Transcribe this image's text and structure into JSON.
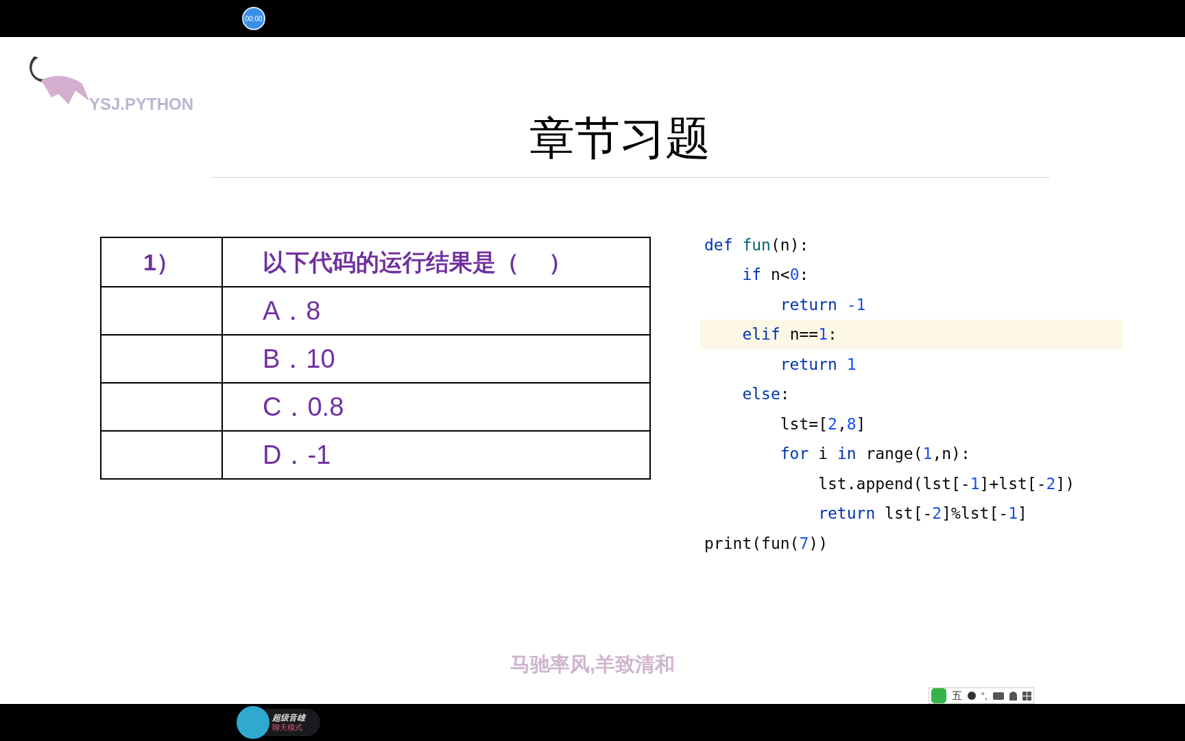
{
  "player": {
    "timer": "00:00"
  },
  "slide": {
    "logo_text": "YSJ.PYTHON",
    "title": "章节习题",
    "table": {
      "rows": [
        {
          "number": "1）",
          "text": "以下代码的运行结果是（　 ）",
          "kind": "question"
        },
        {
          "number": "",
          "text": "A．8",
          "kind": "option"
        },
        {
          "number": "",
          "text": "B．10",
          "kind": "option"
        },
        {
          "number": "",
          "text": "C．0.8",
          "kind": "option"
        },
        {
          "number": "",
          "text": "D．-1",
          "kind": "option"
        }
      ]
    },
    "code": [
      {
        "highlighted": false,
        "tokens": [
          {
            "t": "def ",
            "kind": "kw"
          },
          {
            "t": "fun",
            "kind": "fn"
          },
          {
            "t": "(n):",
            "kind": "plain"
          }
        ]
      },
      {
        "highlighted": false,
        "tokens": [
          {
            "t": "    if ",
            "kind": "kw"
          },
          {
            "t": "n<",
            "kind": "plain"
          },
          {
            "t": "0",
            "kind": "num"
          },
          {
            "t": ":",
            "kind": "plain"
          }
        ]
      },
      {
        "highlighted": false,
        "tokens": [
          {
            "t": "        return ",
            "kind": "kw"
          },
          {
            "t": "-1",
            "kind": "num"
          }
        ]
      },
      {
        "highlighted": true,
        "tokens": [
          {
            "t": "    elif ",
            "kind": "kw"
          },
          {
            "t": "n==",
            "kind": "plain"
          },
          {
            "t": "1",
            "kind": "num"
          },
          {
            "t": ":",
            "kind": "plain"
          }
        ]
      },
      {
        "highlighted": false,
        "tokens": [
          {
            "t": "        return ",
            "kind": "kw"
          },
          {
            "t": "1",
            "kind": "num"
          }
        ]
      },
      {
        "highlighted": false,
        "tokens": [
          {
            "t": "    else",
            "kind": "kw"
          },
          {
            "t": ":",
            "kind": "plain"
          }
        ]
      },
      {
        "highlighted": false,
        "tokens": [
          {
            "t": "        lst=[",
            "kind": "plain"
          },
          {
            "t": "2",
            "kind": "num"
          },
          {
            "t": ",",
            "kind": "plain"
          },
          {
            "t": "8",
            "kind": "num"
          },
          {
            "t": "]",
            "kind": "plain"
          }
        ]
      },
      {
        "highlighted": false,
        "tokens": [
          {
            "t": "        for ",
            "kind": "kw"
          },
          {
            "t": "i ",
            "kind": "plain"
          },
          {
            "t": "in ",
            "kind": "kw"
          },
          {
            "t": "range(",
            "kind": "plain"
          },
          {
            "t": "1",
            "kind": "num"
          },
          {
            "t": ",n):",
            "kind": "plain"
          }
        ]
      },
      {
        "highlighted": false,
        "tokens": [
          {
            "t": "            lst.append(lst[-",
            "kind": "plain"
          },
          {
            "t": "1",
            "kind": "num"
          },
          {
            "t": "]+lst[-",
            "kind": "plain"
          },
          {
            "t": "2",
            "kind": "num"
          },
          {
            "t": "])",
            "kind": "plain"
          }
        ]
      },
      {
        "highlighted": false,
        "tokens": [
          {
            "t": "            return ",
            "kind": "kw"
          },
          {
            "t": "lst[-",
            "kind": "plain"
          },
          {
            "t": "2",
            "kind": "num"
          },
          {
            "t": "]%lst[-",
            "kind": "plain"
          },
          {
            "t": "1",
            "kind": "num"
          },
          {
            "t": "]",
            "kind": "plain"
          }
        ]
      },
      {
        "highlighted": false,
        "tokens": [
          {
            "t": "print(fun(",
            "kind": "plain"
          },
          {
            "t": "7",
            "kind": "num"
          },
          {
            "t": "))",
            "kind": "plain"
          }
        ]
      }
    ],
    "motto": "马驰率风,羊致清和"
  },
  "ime_bar": {
    "mode": "五",
    "punct": "°,"
  },
  "voice_app": {
    "name": "超级音雄",
    "mode": "聊天模式"
  }
}
